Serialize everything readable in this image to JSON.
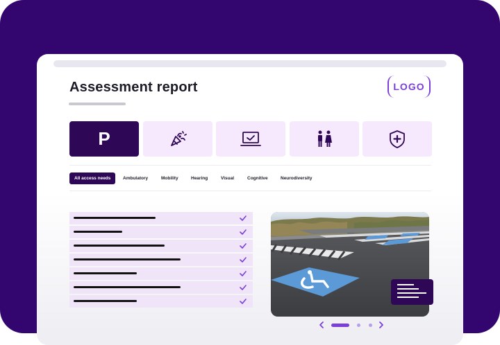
{
  "header": {
    "title": "Assessment report",
    "logo_text": "LOGO"
  },
  "categories": [
    {
      "label": "P",
      "icon": "parking-icon",
      "active": true
    },
    {
      "label": "",
      "icon": "celebration-icon",
      "active": false
    },
    {
      "label": "",
      "icon": "laptop-check-icon",
      "active": false
    },
    {
      "label": "",
      "icon": "restroom-icon",
      "active": false
    },
    {
      "label": "",
      "icon": "shield-plus-icon",
      "active": false
    }
  ],
  "filters": [
    {
      "label": "All access needs",
      "active": true
    },
    {
      "label": "Ambulatory",
      "active": false
    },
    {
      "label": "Mobility",
      "active": false
    },
    {
      "label": "Hearing",
      "active": false
    },
    {
      "label": "Visual",
      "active": false
    },
    {
      "label": "Cognitive",
      "active": false
    },
    {
      "label": "Neurodiversity",
      "active": false
    }
  ],
  "checklist_items_checked": [
    true,
    true,
    true,
    true,
    true,
    true,
    true
  ],
  "carousel": {
    "slide_count": 3,
    "active_slide": 1
  },
  "colors": {
    "brand_purple": "#33066f",
    "dark_purple": "#2e0756",
    "accent_purple": "#7b3fd9",
    "light_lavender": "#f6e9fd",
    "row_lavender": "#efe4f8",
    "parking_blue": "#5b9ad6"
  }
}
